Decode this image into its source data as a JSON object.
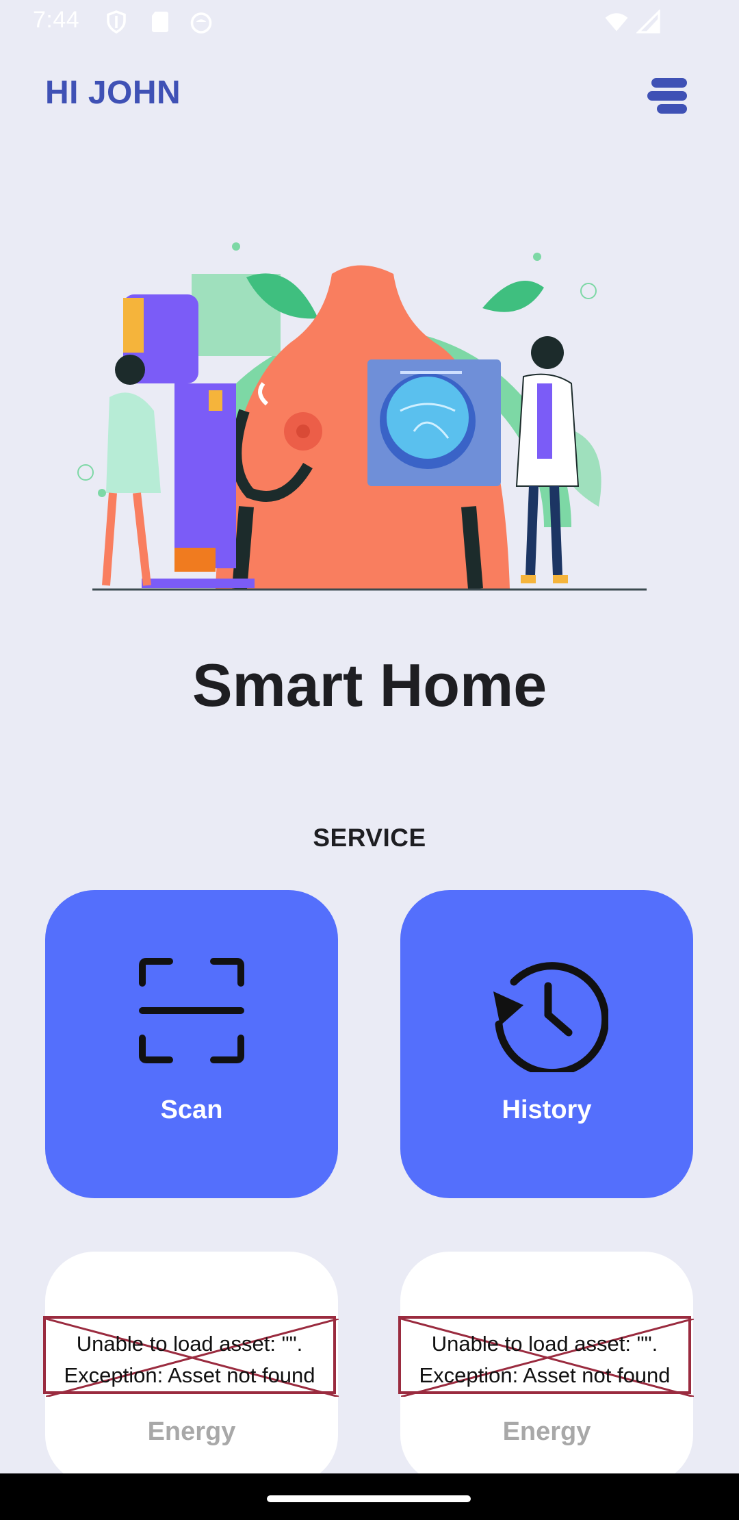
{
  "status_bar": {
    "time": "7:44"
  },
  "header": {
    "greeting": "HI JOHN"
  },
  "main": {
    "title": "Smart Home",
    "section_title": "SERVICE",
    "cards": [
      {
        "label": "Scan",
        "icon": "scan-icon"
      },
      {
        "label": "History",
        "icon": "history-icon"
      },
      {
        "label": "Energy",
        "error_line1": "Unable to load asset: \"\".",
        "error_line2": "Exception: Asset not found"
      },
      {
        "label": "Energy",
        "error_line1": "Unable to load asset: \"\".",
        "error_line2": "Exception: Asset not found"
      }
    ]
  },
  "colors": {
    "background": "#eaebf5",
    "accent": "#546ffc",
    "greeting": "#3f51b5",
    "error_border": "#9a2b3f"
  }
}
